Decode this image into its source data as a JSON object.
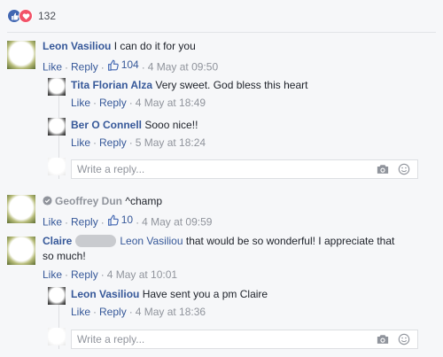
{
  "reactions": {
    "count": "132",
    "icons": [
      "like-icon",
      "love-icon"
    ],
    "like_color": "#4267b2",
    "love_color": "#f25268"
  },
  "comments": [
    {
      "author": "Leon Vasiliou",
      "text": "I can do it for you",
      "like_label": "Like",
      "reply_label": "Reply",
      "like_count": "104",
      "time": "4 May at 09:50",
      "replies": [
        {
          "author": "Tita Florian Alza",
          "text": "Very sweet. God bless this heart",
          "like_label": "Like",
          "reply_label": "Reply",
          "time": "4 May at 18:49"
        },
        {
          "author": "Ber O Connell",
          "text": "Sooo nice!!",
          "like_label": "Like",
          "reply_label": "Reply",
          "time": "5 May at 18:24"
        }
      ],
      "reply_placeholder": "Write a reply..."
    },
    {
      "author": "Geoffrey Dun",
      "text": "^champ",
      "like_label": "Like",
      "reply_label": "Reply",
      "like_count": "10",
      "time": "4 May at 09:59"
    },
    {
      "author": "Claire",
      "mention": "Leon Vasiliou",
      "text_line1": "that would be so wonderful! I appreciate that",
      "text_line2": "so much!",
      "like_label": "Like",
      "reply_label": "Reply",
      "time": "4 May at 10:01",
      "replies": [
        {
          "author": "Leon Vasiliou",
          "text": "Have sent you a pm Claire",
          "like_label": "Like",
          "reply_label": "Reply",
          "time": "4 May at 18:36"
        }
      ],
      "reply_placeholder": "Write a reply..."
    }
  ],
  "colors": {
    "link": "#365899",
    "meta": "#90949c",
    "text": "#1d2129",
    "background": "#f6f7f9"
  }
}
